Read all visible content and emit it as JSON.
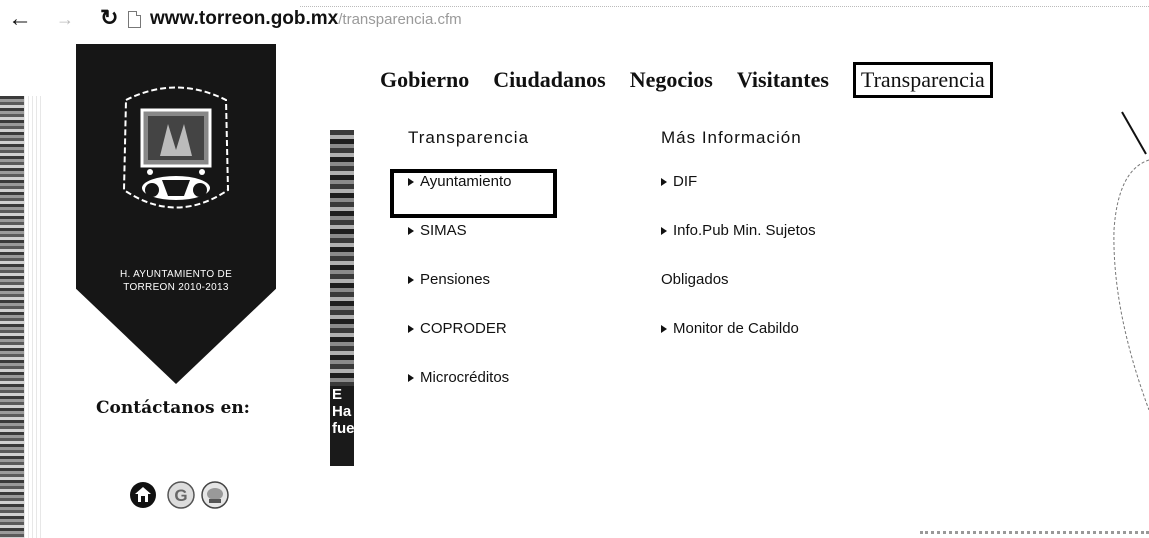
{
  "browser": {
    "back_icon": "arrow-left-icon",
    "forward_icon": "arrow-right-icon",
    "reload_icon": "reload-icon",
    "url_domain": "www.torreon.gob.mx",
    "url_path": "/transparencia.cfm"
  },
  "banner": {
    "caption_line1": "H. AYUNTAMIENTO DE",
    "caption_line2": "TORREON 2010-2013"
  },
  "contact": {
    "label": "Contáctanos en:",
    "icons": [
      "home-icon",
      "google-icon",
      "social-icon"
    ]
  },
  "mid_strip": {
    "lines": [
      "E",
      "Ha",
      "fue"
    ]
  },
  "top_nav": {
    "items": [
      "Gobierno",
      "Ciudadanos",
      "Negocios",
      "Visitantes",
      "Transparencia"
    ],
    "active": "Transparencia"
  },
  "dropdown": {
    "col1": {
      "heading": "Transparencia",
      "items": [
        "Ayuntamiento",
        "SIMAS",
        "Pensiones",
        "COPRODER",
        "Microcréditos"
      ]
    },
    "col2": {
      "heading": "Más Información",
      "items": [
        "DIF",
        "Info.Pub Min. Sujetos",
        "Obligados",
        "Monitor de Cabildo"
      ]
    }
  }
}
